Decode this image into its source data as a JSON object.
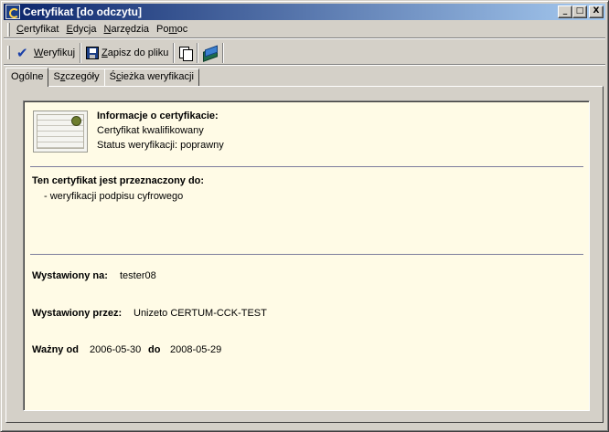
{
  "window": {
    "title": "Certyfikat [do odczytu]",
    "controls": {
      "minimize": "_",
      "maximize": "□",
      "close": "X"
    }
  },
  "menu": [
    {
      "pre": "",
      "key": "C",
      "post": "ertyfikat"
    },
    {
      "pre": "",
      "key": "E",
      "post": "dycja"
    },
    {
      "pre": "",
      "key": "N",
      "post": "arzędzia"
    },
    {
      "pre": "Po",
      "key": "m",
      "post": "oc"
    }
  ],
  "toolbar": {
    "verify": {
      "pre": "",
      "key": "W",
      "post": "eryfikuj",
      "icon": "check-icon"
    },
    "save": {
      "pre": "",
      "key": "Z",
      "post": "apisz do pliku",
      "icon": "floppy-disk-icon"
    },
    "copy_icon": "copy-icon",
    "book_icon": "book-icon"
  },
  "tabs": [
    {
      "pre": "O",
      "key": "g",
      "post": "ólne",
      "active": true
    },
    {
      "pre": "S",
      "key": "z",
      "post": "czegóły",
      "active": false
    },
    {
      "pre": "Ś",
      "key": "c",
      "post": "ieżka weryfikacji",
      "active": false
    }
  ],
  "general": {
    "info_heading": "Informacje o certyfikacie:",
    "cert_type": "Certyfikat kwalifikowany",
    "verification_status": "Status weryfikacji: poprawny",
    "purpose_heading": "Ten certyfikat jest przeznaczony do:",
    "purpose_item": "- weryfikacji podpisu cyfrowego",
    "issued_to_label": "Wystawiony na:",
    "issued_to_value": "tester08",
    "issued_by_label": "Wystawiony przez:",
    "issued_by_value": "Unizeto CERTUM-CCK-TEST",
    "valid_from_label": "Ważny od",
    "valid_from_value": "2006-05-30",
    "valid_to_label": "do",
    "valid_to_value": "2008-05-29"
  },
  "colors": {
    "title_gradient_start": "#0a246a",
    "title_gradient_end": "#a6caf0",
    "panel_background": "#fffbe6",
    "separator": "#7c7c9c"
  }
}
